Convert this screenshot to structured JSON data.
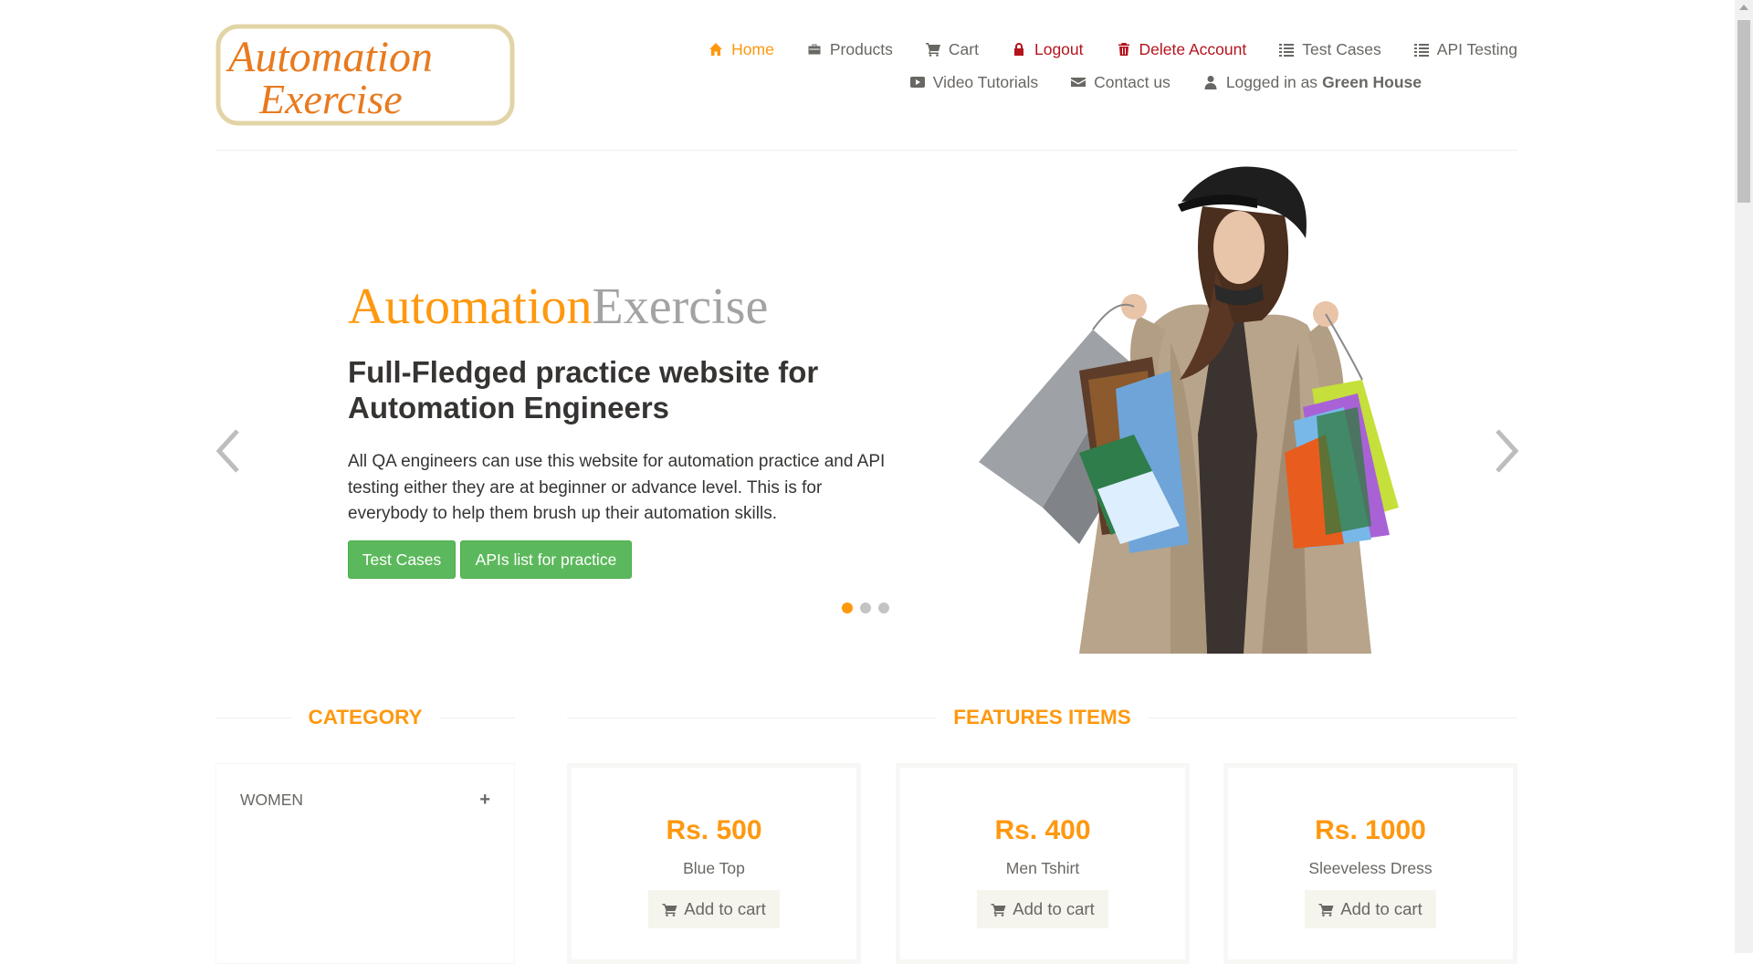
{
  "header": {
    "logo": {
      "line1": "Automation",
      "line2": "Exercise"
    },
    "nav_row1": [
      {
        "label": "Home",
        "icon": "home-icon"
      },
      {
        "label": "Products",
        "icon": "briefcase-icon"
      },
      {
        "label": "Cart",
        "icon": "cart-icon"
      },
      {
        "label": "Logout",
        "icon": "lock-icon"
      },
      {
        "label": "Delete Account",
        "icon": "trash-icon"
      },
      {
        "label": "Test Cases",
        "icon": "list-icon"
      },
      {
        "label": "API Testing",
        "icon": "list-icon"
      }
    ],
    "nav_row2": [
      {
        "label": "Video Tutorials",
        "icon": "youtube-play-icon"
      },
      {
        "label": "Contact us",
        "icon": "envelope-icon"
      },
      {
        "label": "Logged in as",
        "user": "Green House",
        "icon": "user-icon"
      }
    ]
  },
  "slider": {
    "brand_part1": "Automation",
    "brand_part2": "Exercise",
    "headline": "Full-Fledged practice website for Automation Engineers",
    "description": "All QA engineers can use this website for automation practice and API testing either they are at beginner or advance level. This is for everybody to help them brush up their automation skills.",
    "btn_test_cases": "Test Cases",
    "btn_apis": "APIs list for practice",
    "active_slide": 1,
    "slide_count": 3
  },
  "category": {
    "title": "CATEGORY",
    "items": [
      {
        "label": "WOMEN",
        "toggle": "+"
      }
    ]
  },
  "features": {
    "title": "FEATURES ITEMS",
    "products": [
      {
        "price": "Rs. 500",
        "name": "Blue Top",
        "action": "Add to cart"
      },
      {
        "price": "Rs. 400",
        "name": "Men Tshirt",
        "action": "Add to cart"
      },
      {
        "price": "Rs. 1000",
        "name": "Sleeveless Dress",
        "action": "Add to cart"
      }
    ]
  },
  "colors": {
    "accent": "#FE980F",
    "danger": "#B4141E",
    "success": "#5cb85c",
    "text": "#696763",
    "heading": "#363432"
  }
}
